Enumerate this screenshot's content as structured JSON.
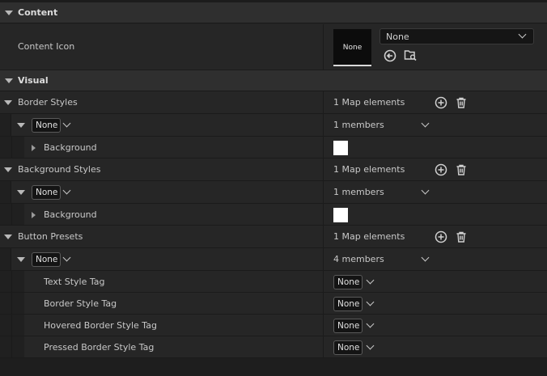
{
  "categories": {
    "content": "Content",
    "visual": "Visual"
  },
  "content_icon": {
    "label": "Content Icon",
    "thumb_text": "None",
    "dropdown_value": "None"
  },
  "border_styles": {
    "label": "Border Styles",
    "map_count": "1 Map elements",
    "key": "None",
    "members": "1 members",
    "child": "Background"
  },
  "background_styles": {
    "label": "Background Styles",
    "map_count": "1 Map elements",
    "key": "None",
    "members": "1 members",
    "child": "Background"
  },
  "button_presets": {
    "label": "Button Presets",
    "map_count": "1 Map elements",
    "key": "None",
    "members": "4 members",
    "fields": [
      {
        "label": "Text Style Tag",
        "value": "None"
      },
      {
        "label": "Border Style Tag",
        "value": "None"
      },
      {
        "label": "Hovered Border Style Tag",
        "value": "None"
      },
      {
        "label": "Pressed Border Style Tag",
        "value": "None"
      }
    ]
  },
  "colors": {
    "swatch": "#ffffff",
    "panel_bg": "#262626",
    "category_bg": "#2f2f2f"
  },
  "icons": [
    "collapse-arrow-icon",
    "add-element-icon",
    "trash-icon",
    "use-selected-icon",
    "browse-asset-icon",
    "expand-arrow-icon",
    "chevron-down-icon"
  ]
}
